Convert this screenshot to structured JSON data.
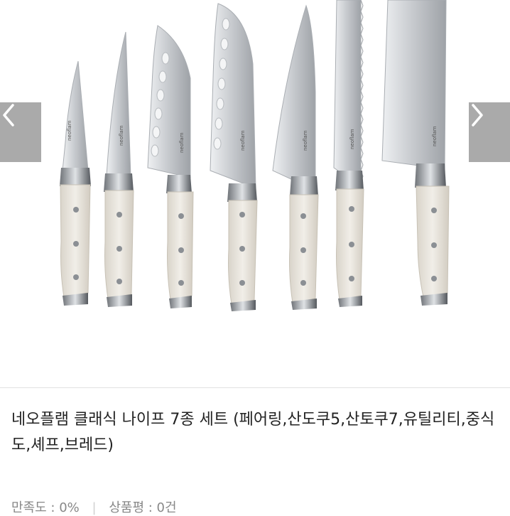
{
  "product": {
    "brand_mark": "neoflam",
    "title": "네오플램 클래식 나이프 7종 세트 (페어링,산도쿠5,산토쿠7,유틸리티,중식도,셰프,브레드)"
  },
  "stats": {
    "satisfaction_label": "만족도",
    "satisfaction_value": "0%",
    "reviews_label": "상품평",
    "reviews_value": "0건"
  },
  "gallery": {
    "prev_icon": "chevron-left-icon",
    "next_icon": "chevron-right-icon",
    "knives": [
      "paring",
      "utility",
      "santoku-5",
      "santoku-7",
      "chef",
      "bread",
      "cleaver"
    ]
  },
  "colors": {
    "nav_button": "#aaaaaa",
    "handle": "#e6e1d8",
    "blade": "#c9ccd0",
    "title_text": "#222222",
    "meta_text": "#888888"
  }
}
